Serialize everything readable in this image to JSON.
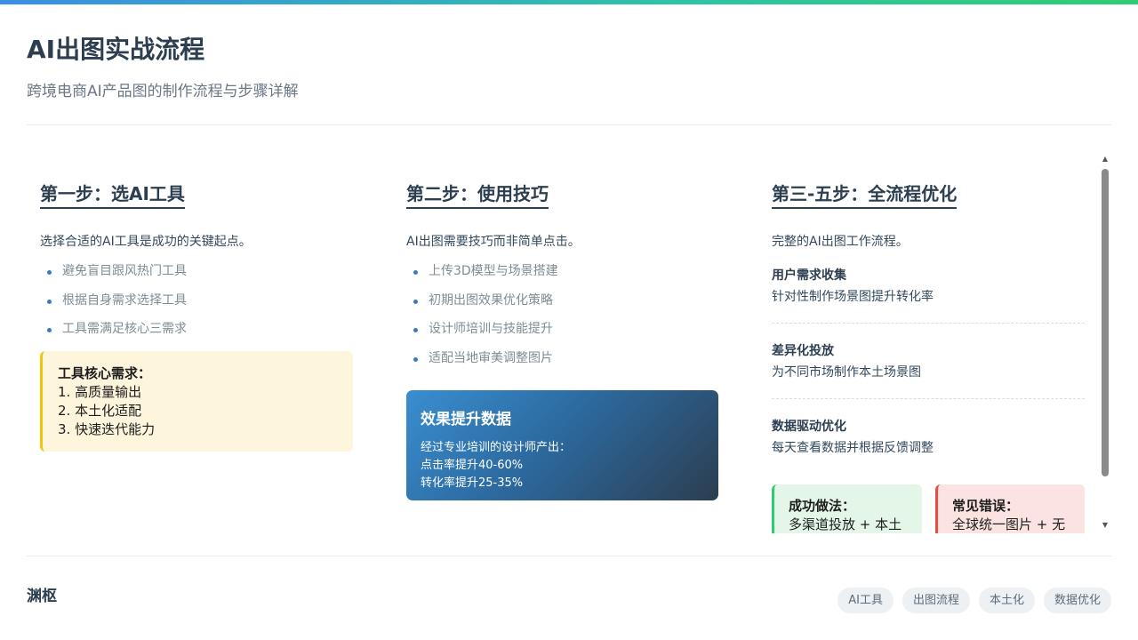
{
  "header": {
    "title": "AI出图实战流程",
    "subtitle": "跨境电商AI产品图的制作流程与步骤详解"
  },
  "colors": {
    "accent_blue": "#3a8ee6",
    "accent_green": "#2ecc71",
    "heading": "#2c3e50",
    "yellow_accent": "#f1c40f",
    "red_accent": "#e74c3c"
  },
  "step1": {
    "title": "第一步：选AI工具",
    "intro": "选择合适的AI工具是成功的关键起点。",
    "bullets": [
      "避免盲目跟风热门工具",
      "根据自身需求选择工具",
      "工具需满足核心三需求"
    ],
    "note_title": "工具核心需求：",
    "note_lines": [
      "1. 高质量输出",
      "2. 本土化适配",
      "3. 快速迭代能力"
    ]
  },
  "step2": {
    "title": "第二步：使用技巧",
    "intro": "AI出图需要技巧而非简单点击。",
    "bullets": [
      "上传3D模型与场景搭建",
      "初期出图效果优化策略",
      "设计师培训与技能提升",
      "适配当地审美调整图片"
    ],
    "card_title": "效果提升数据",
    "card_lines": [
      "经过专业培训的设计师产出：",
      "点击率提升40-60%",
      "转化率提升25-35%"
    ]
  },
  "step3": {
    "title": "第三-五步：全流程优化",
    "intro": "完整的AI出图工作流程。",
    "items": [
      {
        "title": "用户需求收集",
        "desc": "针对性制作场景图提升转化率"
      },
      {
        "title": "差异化投放",
        "desc": "为不同市场制作本土场景图"
      },
      {
        "title": "数据驱动优化",
        "desc": "每天查看数据并根据反馈调整"
      }
    ],
    "success_title": "成功做法：",
    "success_text": "多渠道投放 + 本土场景 + 数据跟踪",
    "mistake_title": "常见错误：",
    "mistake_text": "全球统一图片 + 无数据反馈 + 不优化"
  },
  "footer": {
    "author": "渊枢",
    "tags": [
      "AI工具",
      "出图流程",
      "本土化",
      "数据优化"
    ]
  },
  "icons": {
    "scroll_up": "triangle-up-icon",
    "scroll_down": "triangle-down-icon"
  }
}
